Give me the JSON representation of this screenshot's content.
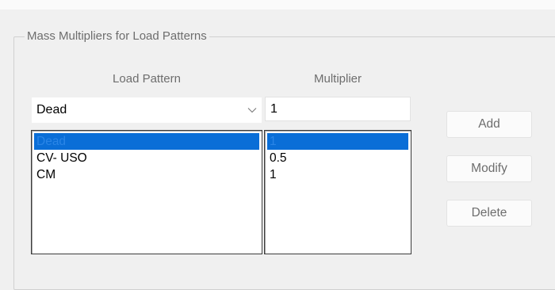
{
  "group": {
    "title": "Mass Multipliers for Load Patterns"
  },
  "headers": {
    "load_pattern": "Load Pattern",
    "multiplier": "Multiplier"
  },
  "inputs": {
    "load_pattern_selected": "Dead",
    "multiplier_value": "1"
  },
  "list": {
    "load_patterns": [
      "Dead",
      "CV- USO",
      "CM"
    ],
    "multipliers": [
      "1",
      "0.5",
      "1"
    ],
    "selected_index": 0
  },
  "buttons": {
    "add": "Add",
    "modify": "Modify",
    "delete": "Delete"
  },
  "icons": {
    "dropdown": "chevron-down-icon"
  },
  "colors": {
    "selection": "#0a6ed7",
    "disabled_text": "#6d6d6d"
  }
}
